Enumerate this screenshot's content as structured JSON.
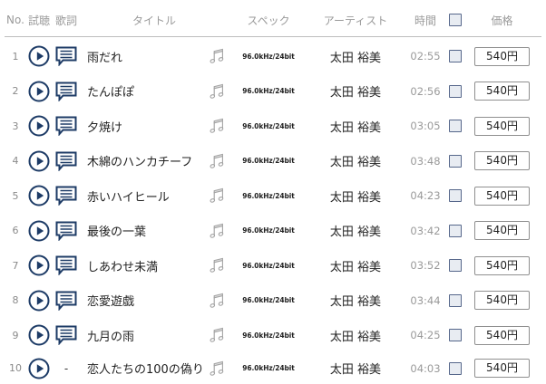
{
  "theme": {
    "accent": "#1d3b66"
  },
  "icons": {
    "preview": "play-circle-icon",
    "lyrics": "lyrics-icon",
    "format": "music-note-icon"
  },
  "header": {
    "no": "No.",
    "preview": "試聴",
    "lyrics": "歌詞",
    "title": "タイトル",
    "spec": "スペック",
    "artist": "アーティスト",
    "time": "時間",
    "select_all_checked": false,
    "price": "価格"
  },
  "tracks": [
    {
      "no": "1",
      "title": "雨だれ",
      "lyrics_available": true,
      "spec": "96.0kHz/24bit",
      "artist": "太田 裕美",
      "time": "02:55",
      "checked": false,
      "price": "540円"
    },
    {
      "no": "2",
      "title": "たんぽぽ",
      "lyrics_available": true,
      "spec": "96.0kHz/24bit",
      "artist": "太田 裕美",
      "time": "02:56",
      "checked": false,
      "price": "540円"
    },
    {
      "no": "3",
      "title": "夕焼け",
      "lyrics_available": true,
      "spec": "96.0kHz/24bit",
      "artist": "太田 裕美",
      "time": "03:05",
      "checked": false,
      "price": "540円"
    },
    {
      "no": "4",
      "title": "木綿のハンカチーフ",
      "lyrics_available": true,
      "spec": "96.0kHz/24bit",
      "artist": "太田 裕美",
      "time": "03:48",
      "checked": false,
      "price": "540円"
    },
    {
      "no": "5",
      "title": "赤いハイヒール",
      "lyrics_available": true,
      "spec": "96.0kHz/24bit",
      "artist": "太田 裕美",
      "time": "04:23",
      "checked": false,
      "price": "540円"
    },
    {
      "no": "6",
      "title": "最後の一葉",
      "lyrics_available": true,
      "spec": "96.0kHz/24bit",
      "artist": "太田 裕美",
      "time": "03:42",
      "checked": false,
      "price": "540円"
    },
    {
      "no": "7",
      "title": "しあわせ未満",
      "lyrics_available": true,
      "spec": "96.0kHz/24bit",
      "artist": "太田 裕美",
      "time": "03:52",
      "checked": false,
      "price": "540円"
    },
    {
      "no": "8",
      "title": "恋愛遊戯",
      "lyrics_available": true,
      "spec": "96.0kHz/24bit",
      "artist": "太田 裕美",
      "time": "03:44",
      "checked": false,
      "price": "540円"
    },
    {
      "no": "9",
      "title": "九月の雨",
      "lyrics_available": true,
      "spec": "96.0kHz/24bit",
      "artist": "太田 裕美",
      "time": "04:25",
      "checked": false,
      "price": "540円"
    },
    {
      "no": "10",
      "title": "恋人たちの100の偽り",
      "lyrics_available": false,
      "lyrics_placeholder": "-",
      "spec": "96.0kHz/24bit",
      "artist": "太田 裕美",
      "time": "04:03",
      "checked": false,
      "price": "540円"
    }
  ]
}
